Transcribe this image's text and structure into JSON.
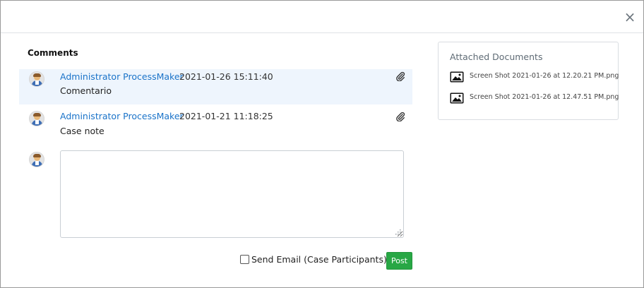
{
  "dialog": {
    "close_label": "×"
  },
  "comments": {
    "title": "Comments",
    "items": [
      {
        "author": "Administrator ProcessMaker",
        "date": "2021-01-26 15:11:40",
        "text": "Comentario",
        "has_attachment": true,
        "highlighted": true
      },
      {
        "author": "Administrator ProcessMaker",
        "date": "2021-01-21 11:18:25",
        "text": "Case note",
        "has_attachment": true,
        "highlighted": false
      }
    ],
    "new_comment": {
      "value": "",
      "placeholder": ""
    },
    "send_email_label": "Send Email (Case Participants)",
    "send_email_checked": false,
    "post_label": "Post"
  },
  "documents": {
    "title": "Attached Documents",
    "files": [
      {
        "name": "Screen Shot 2021-01-26 at 12.20.21 PM.png",
        "icon": "image-icon"
      },
      {
        "name": "Screen Shot 2021-01-26 at 12.47.51 PM.png",
        "icon": "image-icon"
      }
    ]
  },
  "colors": {
    "link": "#1a73c9",
    "highlight_row": "#eef5fd",
    "post_button": "#28a745"
  }
}
